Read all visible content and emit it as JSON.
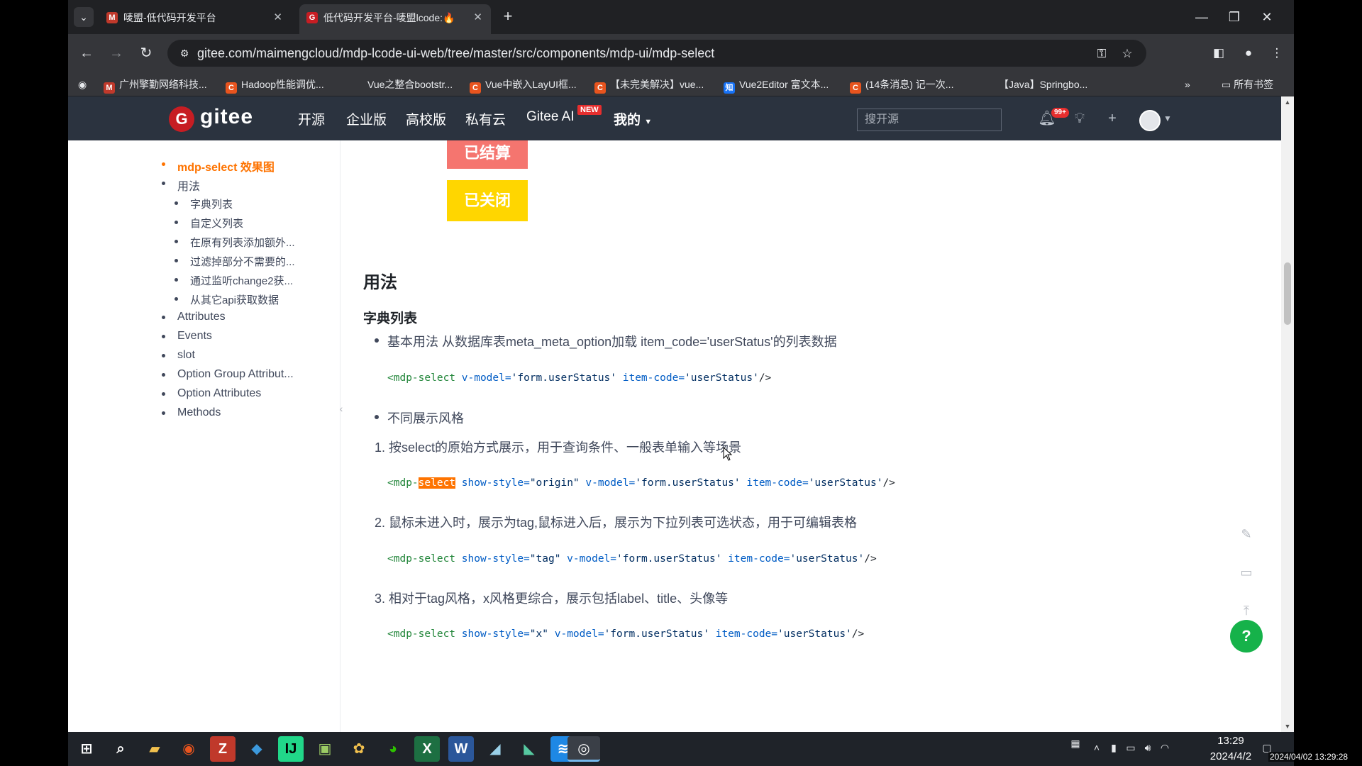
{
  "browser": {
    "tabs": [
      {
        "title": "唛盟-低代码开发平台",
        "favicon": "M",
        "favicon_color": "#c0392b",
        "active": false
      },
      {
        "title": "低代码开发平台-唛盟lcode:🔥",
        "favicon": "G",
        "favicon_color": "#c71d23",
        "active": true
      }
    ],
    "url": "gitee.com/maimengcloud/mdp-lcode-ui-web/tree/master/src/components/mdp-ui/mdp-select",
    "bookmarks": [
      {
        "label": "广州擎勤网络科技...",
        "icon": "M",
        "color": "#c0392b"
      },
      {
        "label": "Hadoop性能调优...",
        "icon": "C",
        "color": "#e8541e"
      },
      {
        "label": "Vue之整合bootstr...",
        "icon": "",
        "color": ""
      },
      {
        "label": "Vue中嵌入LayUI框...",
        "icon": "C",
        "color": "#e8541e"
      },
      {
        "label": "【未完美解决】vue...",
        "icon": "C",
        "color": "#e8541e"
      },
      {
        "label": "Vue2Editor 富文本...",
        "icon": "知",
        "color": "#1772f6"
      },
      {
        "label": "(14条消息) 记一次...",
        "icon": "C",
        "color": "#e8541e"
      },
      {
        "label": "【Java】Springbo...",
        "icon": "",
        "color": ""
      }
    ],
    "bookmarks_overflow": "»",
    "all_bookmarks": "所有书签"
  },
  "gitee": {
    "logo_text": "gitee",
    "nav": [
      "开源",
      "企业版",
      "高校版",
      "私有云",
      "Gitee AI",
      "我的"
    ],
    "new_badge": "NEW",
    "search_placeholder": "搜开源",
    "notif_count": "99+"
  },
  "toc": [
    {
      "label": "mdp-select 效果图",
      "level": 1,
      "active": true
    },
    {
      "label": "用法",
      "level": 1,
      "active": false
    },
    {
      "label": "字典列表",
      "level": 2,
      "active": false
    },
    {
      "label": "自定义列表",
      "level": 2,
      "active": false
    },
    {
      "label": "在原有列表添加额外...",
      "level": 2,
      "active": false
    },
    {
      "label": "过滤掉部分不需要的...",
      "level": 2,
      "active": false
    },
    {
      "label": "通过监听change2获...",
      "level": 2,
      "active": false
    },
    {
      "label": "从其它api获取数据",
      "level": 2,
      "active": false
    },
    {
      "label": "Attributes",
      "level": 1,
      "active": false
    },
    {
      "label": "Events",
      "level": 1,
      "active": false
    },
    {
      "label": "slot",
      "level": 1,
      "active": false
    },
    {
      "label": "Option Group Attribut...",
      "level": 1,
      "active": false
    },
    {
      "label": "Option Attributes",
      "level": 1,
      "active": false
    },
    {
      "label": "Methods",
      "level": 1,
      "active": false
    }
  ],
  "content": {
    "status_tags": [
      {
        "label": "已结算",
        "color": "#f5756f"
      },
      {
        "label": "已关闭",
        "color": "#ffd600"
      }
    ],
    "h2": "用法",
    "h3": "字典列表",
    "bullet1": "基本用法 从数据库表meta_meta_option加载 item_code='userStatus'的列表数据",
    "bullet2": "不同展示风格",
    "item1": "1. 按select的原始方式展示，用于查询条件、一般表单输入等场景",
    "item2": "2. 鼠标未进入时，展示为tag,鼠标进入后，展示为下拉列表可选状态，用于可编辑表格",
    "item3": "3. 相对于tag风格，x风格更综合，展示包括label、title、头像等",
    "code1": {
      "tag": "<mdp-select",
      "a1": " v-model=",
      "v1": "'form.userStatus'",
      "a2": " item-code=",
      "v2": "'userStatus'",
      "end": "/>"
    },
    "code2": {
      "tag_pre": "<mdp-",
      "tag_hl": "select",
      "a0": " show-style=",
      "v0": "\"origin\"",
      "a1": " v-model=",
      "v1": "'form.userStatus'",
      "a2": " item-code=",
      "v2": "'userStatus'",
      "end": "/>"
    },
    "code3": {
      "tag": "<mdp-select",
      "a0": " show-style=",
      "v0": "\"tag\"",
      "a1": " v-model=",
      "v1": "'form.userStatus'",
      "a2": " item-code=",
      "v2": "'userStatus'",
      "end": "/>"
    },
    "code4": {
      "tag": "<mdp-select",
      "a0": " show-style=",
      "v0": "\"x\"",
      "a1": " v-model=",
      "v1": "'form.userStatus'",
      "a2": " item-code=",
      "v2": "'userStatus'",
      "end": "/>"
    }
  },
  "float": {
    "help": "?"
  },
  "taskbar": {
    "time": "13:29",
    "date": "2024/4/2",
    "stamp": "2024/04/02 13:29:28"
  }
}
